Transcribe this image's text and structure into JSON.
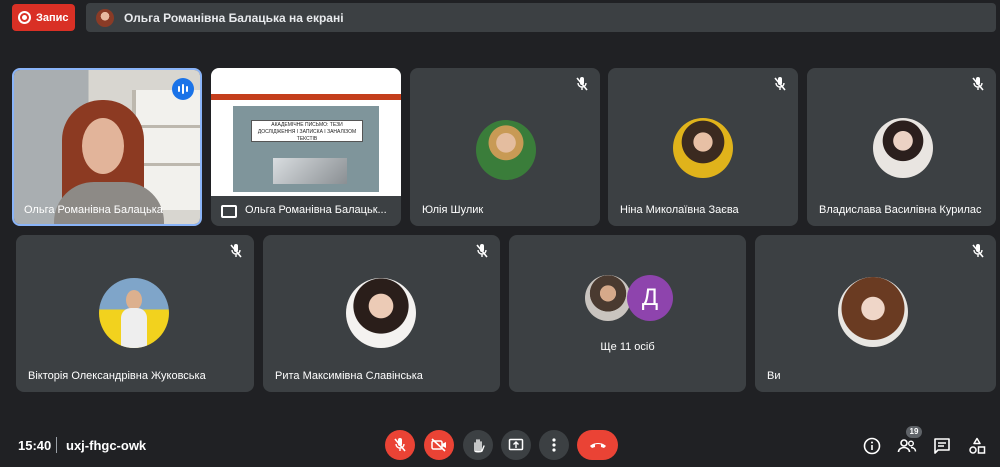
{
  "recording": {
    "label": "Запис"
  },
  "presenting_banner": {
    "text": "Ольга Романівна Балацька на екрані"
  },
  "tiles": [
    {
      "name": "Ольга Романівна Балацька"
    },
    {
      "name": "Ольга Романівна Балацьк..."
    },
    {
      "name": "Юлія Шулик"
    },
    {
      "name": "Ніна Миколаївна Заєва"
    },
    {
      "name": "Владислава Василівна Курилас"
    },
    {
      "name": "Вікторія Олександрівна Жуковська"
    },
    {
      "name": "Рита Максимівна Славінська"
    },
    {
      "name": "Ще 11 осіб",
      "avatar_letter": "Д"
    },
    {
      "name": "Ви"
    }
  ],
  "slide": {
    "title": "АКАДЕМІЧНЕ ПИСЬМО: ТЕЗИ ДОСЛІДЖЕННЯ І ЗАПИСКА І ЗАНАЛІЗОМ ТЕКСТІВ"
  },
  "bottom": {
    "time": "15:40",
    "meeting_code": "uxj-fhgc-owk",
    "participant_count": "19"
  },
  "colors": {
    "background": "#202124",
    "tile": "#3c4043",
    "accent_red": "#ea4335",
    "speaking_blue": "#1a73e8"
  }
}
